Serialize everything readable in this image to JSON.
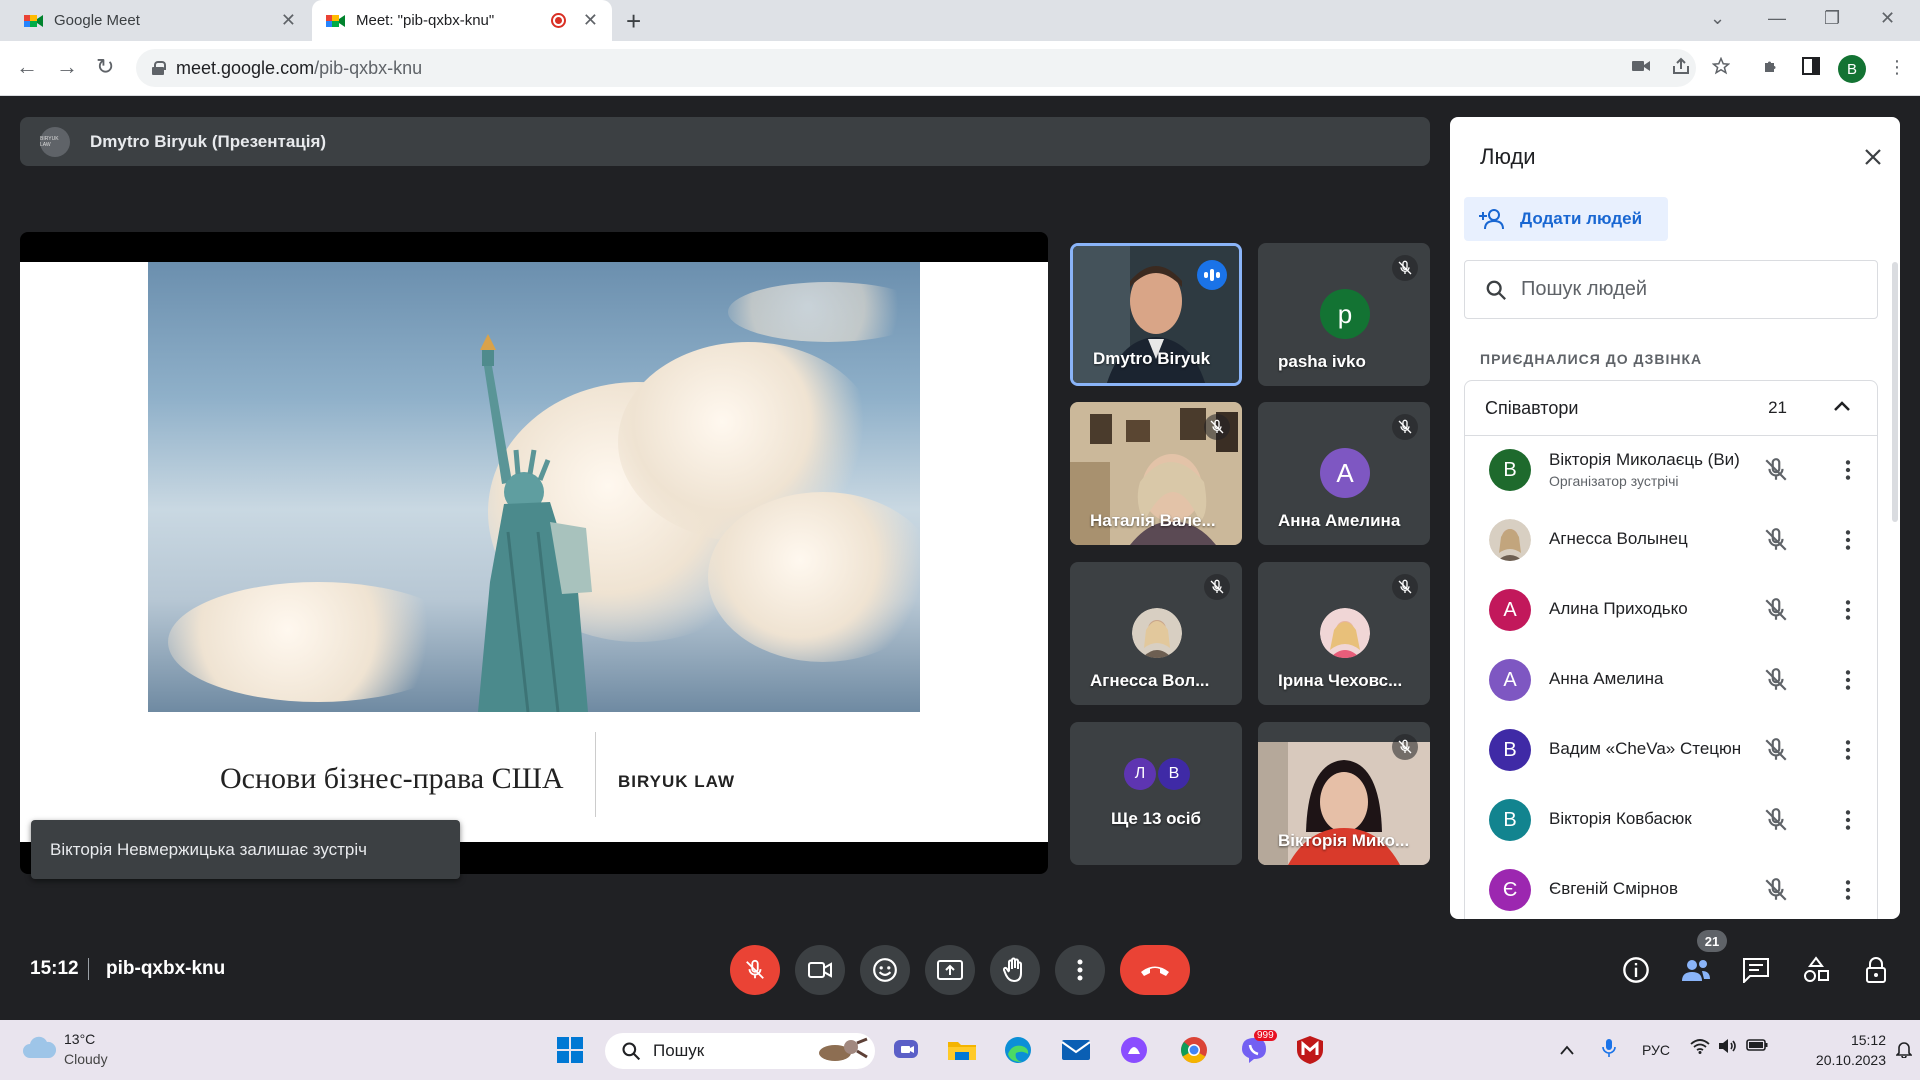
{
  "browser": {
    "tabs": [
      {
        "title": "Google Meet"
      },
      {
        "title": "Meet: \"pib-qxbx-knu\""
      }
    ],
    "address": {
      "host": "meet.google.com",
      "path": "/pib-qxbx-knu"
    },
    "profile_initial": "B"
  },
  "presentation": {
    "presenter_label": "Dmytro Biryuk (Презентація)",
    "logo_text": "BIRYUK LAW",
    "slide_title": "Основи бізнес-права США",
    "slide_brand": "BIRYUK LAW"
  },
  "toast": "Вікторія Невмержицька залишає зустріч",
  "tiles": [
    {
      "name": "Dmytro Biryuk",
      "initial": ""
    },
    {
      "name": "pasha ivko",
      "initial": "p",
      "color": "#137333"
    },
    {
      "name": "Наталія Вале...",
      "initial": ""
    },
    {
      "name": "Анна Амелина",
      "initial": "А",
      "color": "#7e57c2"
    },
    {
      "name": "Агнесса Вол...",
      "initial": ""
    },
    {
      "name": "Ірина Чеховс...",
      "initial": ""
    },
    {
      "name": "Ще 13 осіб",
      "initials": [
        "Л",
        "В"
      ]
    },
    {
      "name": "Вікторія Мико...",
      "initial": ""
    }
  ],
  "meeting": {
    "time": "15:12",
    "code": "pib-qxbx-knu",
    "people_count": "21"
  },
  "panel": {
    "title": "Люди",
    "add_label": "Додати людей",
    "search_placeholder": "Пошук людей",
    "joined_label": "ПРИЄДНАЛИСЯ ДО ДЗВІНКА",
    "group_label": "Співавтори",
    "group_count": "21",
    "participants": [
      {
        "initial": "В",
        "name": "Вікторія Миколаєць (Ви)",
        "role": "Організатор зустрічі",
        "color": "#1e6a2d"
      },
      {
        "initial": "",
        "name": "Агнесса Волынец",
        "role": "",
        "color": "#b9a48a"
      },
      {
        "initial": "А",
        "name": "Алина Приходько",
        "role": "",
        "color": "#c2185b"
      },
      {
        "initial": "А",
        "name": "Анна Амелина",
        "role": "",
        "color": "#7e57c2"
      },
      {
        "initial": "В",
        "name": "Вадим «CheVa» Стецюн",
        "role": "",
        "color": "#3f2aa6"
      },
      {
        "initial": "В",
        "name": "Вікторія Ковбасюк",
        "role": "",
        "color": "#12848f"
      },
      {
        "initial": "Є",
        "name": "Євгеній Смірнов",
        "role": "",
        "color": "#9c27b0"
      }
    ]
  },
  "taskbar": {
    "weather_temp": "13°C",
    "weather_cond": "Cloudy",
    "search_label": "Пошук",
    "lang": "РУС",
    "time": "15:12",
    "date": "20.10.2023",
    "viber_badge": "999"
  }
}
